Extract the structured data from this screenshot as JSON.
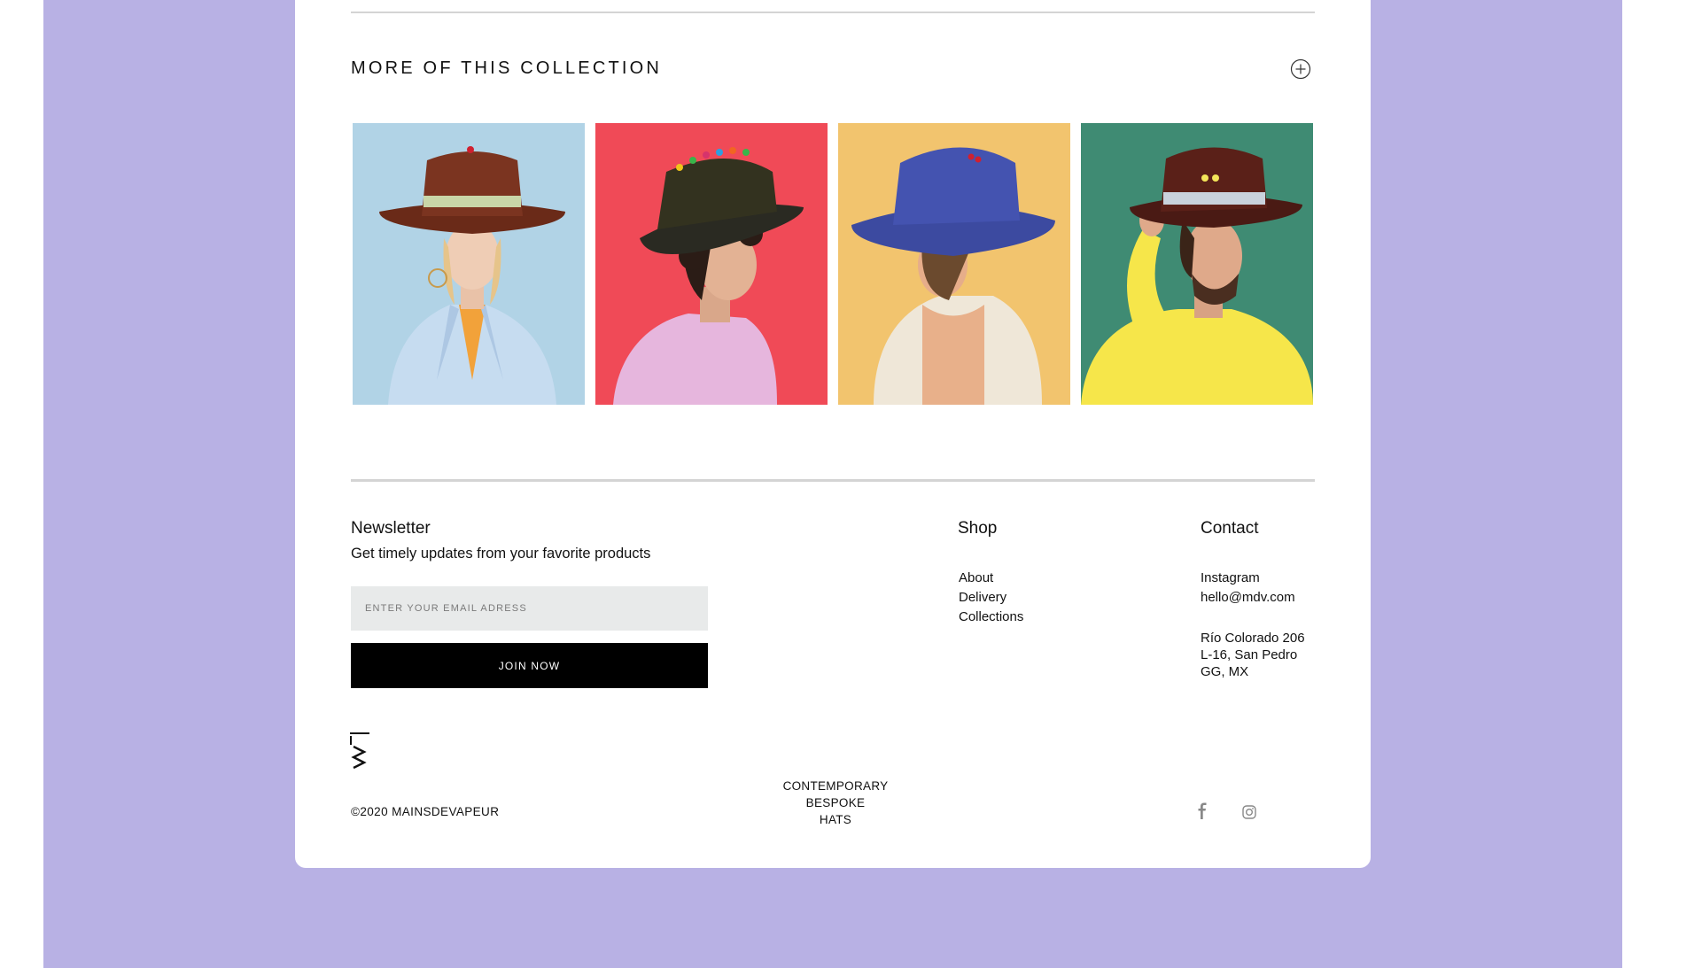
{
  "collection": {
    "title": "MORE OF THIS COLLECTION",
    "expand_icon": "plus-circle-icon",
    "products": [
      {
        "photo": "woman-in-brown-hat-light-blue-background",
        "background_color": "#b1d3e6"
      },
      {
        "photo": "man-in-black-hat-red-background",
        "background_color": "#f04a57"
      },
      {
        "photo": "woman-in-blue-hat-yellow-background",
        "background_color": "#f2c46e"
      },
      {
        "photo": "man-in-brown-hat-green-background",
        "background_color": "#3f8b73"
      }
    ]
  },
  "newsletter": {
    "title": "Newsletter",
    "subtitle": "Get timely updates from your favorite products",
    "email_placeholder": "ENTER YOUR EMAIL ADRESS",
    "join_label": "JOIN NOW"
  },
  "shop": {
    "title": "Shop",
    "links": [
      "About",
      "Delivery",
      "Collections"
    ]
  },
  "contact": {
    "title": "Contact",
    "links": [
      "Instagram",
      "hello@mdv.com"
    ],
    "address": [
      "Río Colorado 206",
      "L-16, San Pedro",
      "GG, MX"
    ]
  },
  "footer": {
    "logo": "mdv-monogram-logo",
    "copyright": "©2020 MAINSDEVAPEUR",
    "tagline": [
      "CONTEMPORARY",
      "BESPOKE",
      "HATS"
    ],
    "social_icons": [
      "facebook-icon",
      "instagram-icon"
    ]
  },
  "colors": {
    "page_background": "#b8b1e4",
    "card_background": "#ffffff",
    "button_background": "#000000",
    "input_background": "#e8eaea"
  }
}
